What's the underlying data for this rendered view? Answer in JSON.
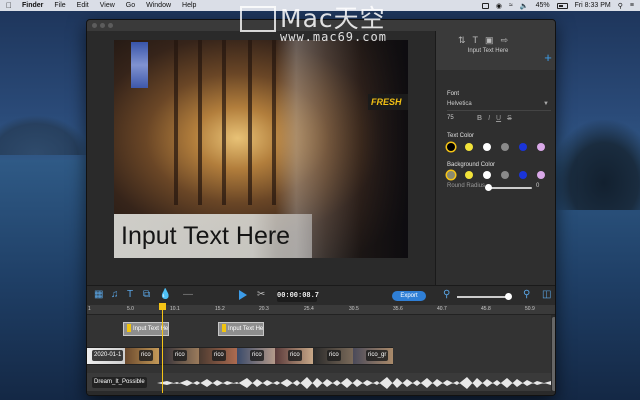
{
  "menubar": {
    "apple": "",
    "items": [
      "Finder",
      "File",
      "Edit",
      "View",
      "Go",
      "Window",
      "Help"
    ],
    "battery": "45%",
    "clock": "Fri 8:33 PM"
  },
  "watermark": {
    "big": "Mac天空",
    "small": "www.mac69.com"
  },
  "preview": {
    "overlay_text": "Input Text Here",
    "sign_text": "FRESH"
  },
  "inspector": {
    "tab_icons": [
      "reorder-icon",
      "text-icon",
      "transition-icon",
      "filter-icon"
    ],
    "layer_title": "Input Text Here",
    "add_label": "+",
    "font_label": "Font",
    "font_name": "Helvetica",
    "font_size": "75",
    "format_buttons": [
      "B",
      "I",
      "U",
      "S"
    ],
    "text_color_label": "Text Color",
    "text_colors": [
      "#000000",
      "#f2e33a",
      "#ffffff",
      "#8a8a8a",
      "#1a34d8",
      "#d9a8e8"
    ],
    "background_color_label": "Background Color",
    "background_colors": [
      "#8a8a70",
      "#f2e33a",
      "#ffffff",
      "#8a8a8a",
      "#1a34d8",
      "#d9a8e8"
    ],
    "round_radius_label": "Round Radius",
    "round_radius_value": "0"
  },
  "toolbar": {
    "timecode": "00:00:08.7",
    "export_label": "Export"
  },
  "ruler": {
    "ticks": [
      "1",
      "5.0",
      "10.1",
      "15.2",
      "20.3",
      "25.4",
      "30.5",
      "35.6",
      "40.7",
      "45.8",
      "50.9"
    ]
  },
  "tracks": {
    "text_clips": [
      {
        "label": "Input Text He"
      },
      {
        "label": "Input Text He"
      }
    ],
    "video_clips": [
      {
        "label": "2020-01-1"
      },
      {
        "label": "rico"
      },
      {
        "label": "rico"
      },
      {
        "label": "rico"
      },
      {
        "label": "rico"
      },
      {
        "label": "rico"
      },
      {
        "label": "rico"
      },
      {
        "label": "rico_gr"
      }
    ],
    "audio_label": "Dream_It_Possible"
  },
  "colors": {
    "accent_blue": "#3c9ce8",
    "playhead": "#f5c416"
  }
}
